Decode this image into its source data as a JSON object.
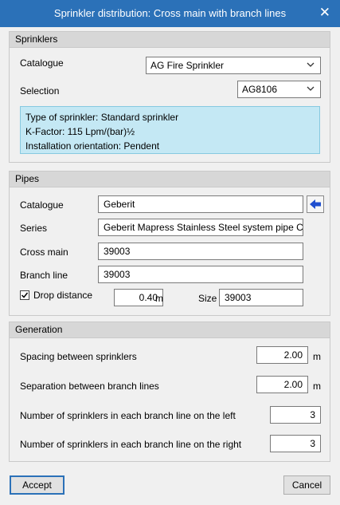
{
  "window": {
    "title": "Sprinkler distribution: Cross main with branch lines",
    "close_glyph": "✕"
  },
  "sprinklers": {
    "header": "Sprinklers",
    "catalogue_label": "Catalogue",
    "catalogue_value": "AG Fire Sprinkler",
    "selection_label": "Selection",
    "selection_value": "AG8106",
    "info_lines": [
      "Type of sprinkler: Standard sprinkler",
      "K-Factor: 115 Lpm/(bar)½",
      "Installation orientation: Pendent"
    ]
  },
  "pipes": {
    "header": "Pipes",
    "catalogue_label": "Catalogue",
    "catalogue_value": "Geberit",
    "series_label": "Series",
    "series_value": "Geberit Mapress Stainless Steel system pipe CrNi",
    "cross_main_label": "Cross main",
    "cross_main_value": "39003",
    "branch_line_label": "Branch line",
    "branch_line_value": "39003",
    "drop_distance_label": "Drop distance",
    "drop_distance_checked": true,
    "drop_distance_value": "0.40",
    "drop_distance_unit": "m",
    "size_label": "Size",
    "size_value": "39003"
  },
  "generation": {
    "header": "Generation",
    "spacing_label": "Spacing between sprinklers",
    "spacing_value": "2.00",
    "spacing_unit": "m",
    "separation_label": "Separation between branch lines",
    "separation_value": "2.00",
    "separation_unit": "m",
    "left_label": "Number of sprinklers in each branch line on the left",
    "left_value": "3",
    "right_label": "Number of sprinklers in each branch line on the right",
    "right_value": "3"
  },
  "buttons": {
    "accept": "Accept",
    "cancel": "Cancel"
  },
  "colors": {
    "titlebar": "#2b71b8",
    "info_bg": "#c4e8f4",
    "arrow": "#1f4fcf"
  }
}
